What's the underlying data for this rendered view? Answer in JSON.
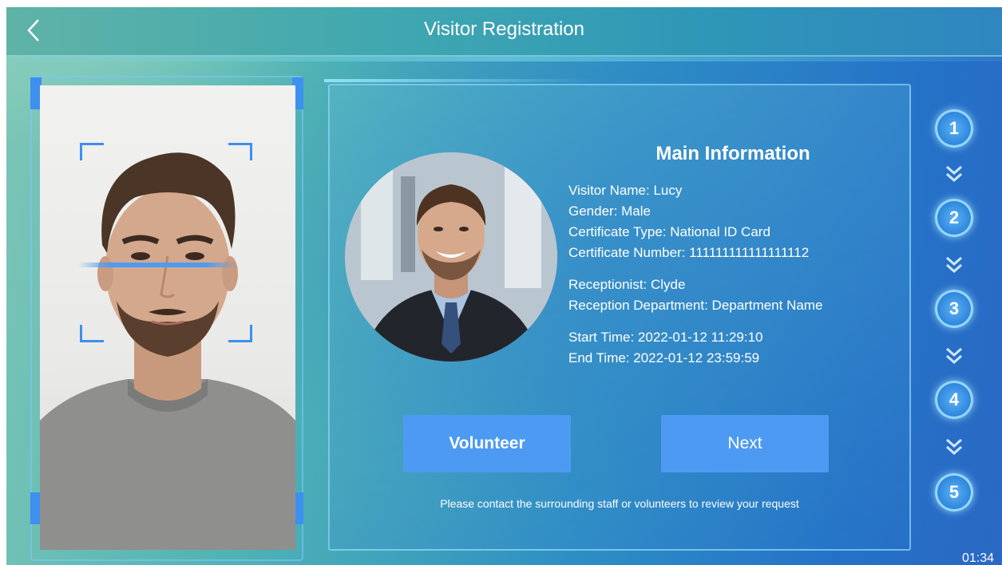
{
  "header": {
    "title": "Visitor Registration",
    "back_icon": "chevron-left-icon"
  },
  "main_info": {
    "title": "Main Information",
    "visitor_name": "Visitor Name: Lucy",
    "gender": "Gender: Male",
    "certificate_type": "Certificate Type: National ID Card",
    "certificate_number": "Certificate Number: 111111111111111112",
    "receptionist": "Receptionist: Clyde",
    "reception_department": "Reception Department: Department Name",
    "start_time": "Start Time: 2022-01-12 11:29:10",
    "end_time": "End Time: 2022-01-12 23:59:59"
  },
  "actions": {
    "volunteer_label": "Volunteer",
    "next_label": "Next"
  },
  "hint": "Please contact the surrounding staff or volunteers to review your request",
  "steps": [
    "1",
    "2",
    "3",
    "4",
    "5"
  ],
  "clock": "01:34",
  "colors": {
    "accent": "#4d9af2",
    "scan_line": "#4d9cf2",
    "text": "#ffffff"
  }
}
